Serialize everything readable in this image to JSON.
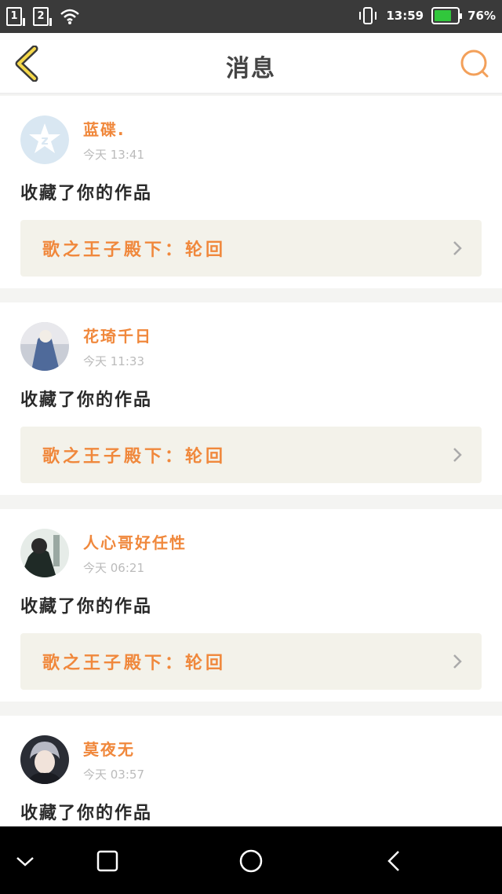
{
  "status_bar": {
    "sim1": "1",
    "sim2": "2",
    "time": "13:59",
    "battery_percent": "76%",
    "battery_level": 0.76,
    "battery_color": "#31c73c"
  },
  "header": {
    "title": "消息"
  },
  "messages": [
    {
      "username": "蓝碟.",
      "time": "今天 13:41",
      "action": "收藏了你的作品",
      "work_title": "歌之王子殿下：轮回"
    },
    {
      "username": "花琦千日",
      "time": "今天 11:33",
      "action": "收藏了你的作品",
      "work_title": "歌之王子殿下：轮回"
    },
    {
      "username": "人心哥好任性",
      "time": "今天 06:21",
      "action": "收藏了你的作品",
      "work_title": "歌之王子殿下：轮回"
    },
    {
      "username": "莫夜无",
      "time": "今天 03:57",
      "action": "收藏了你的作品",
      "work_title": ""
    }
  ],
  "colors": {
    "accent": "#f0883c",
    "header_icon": "#f3a05a"
  }
}
